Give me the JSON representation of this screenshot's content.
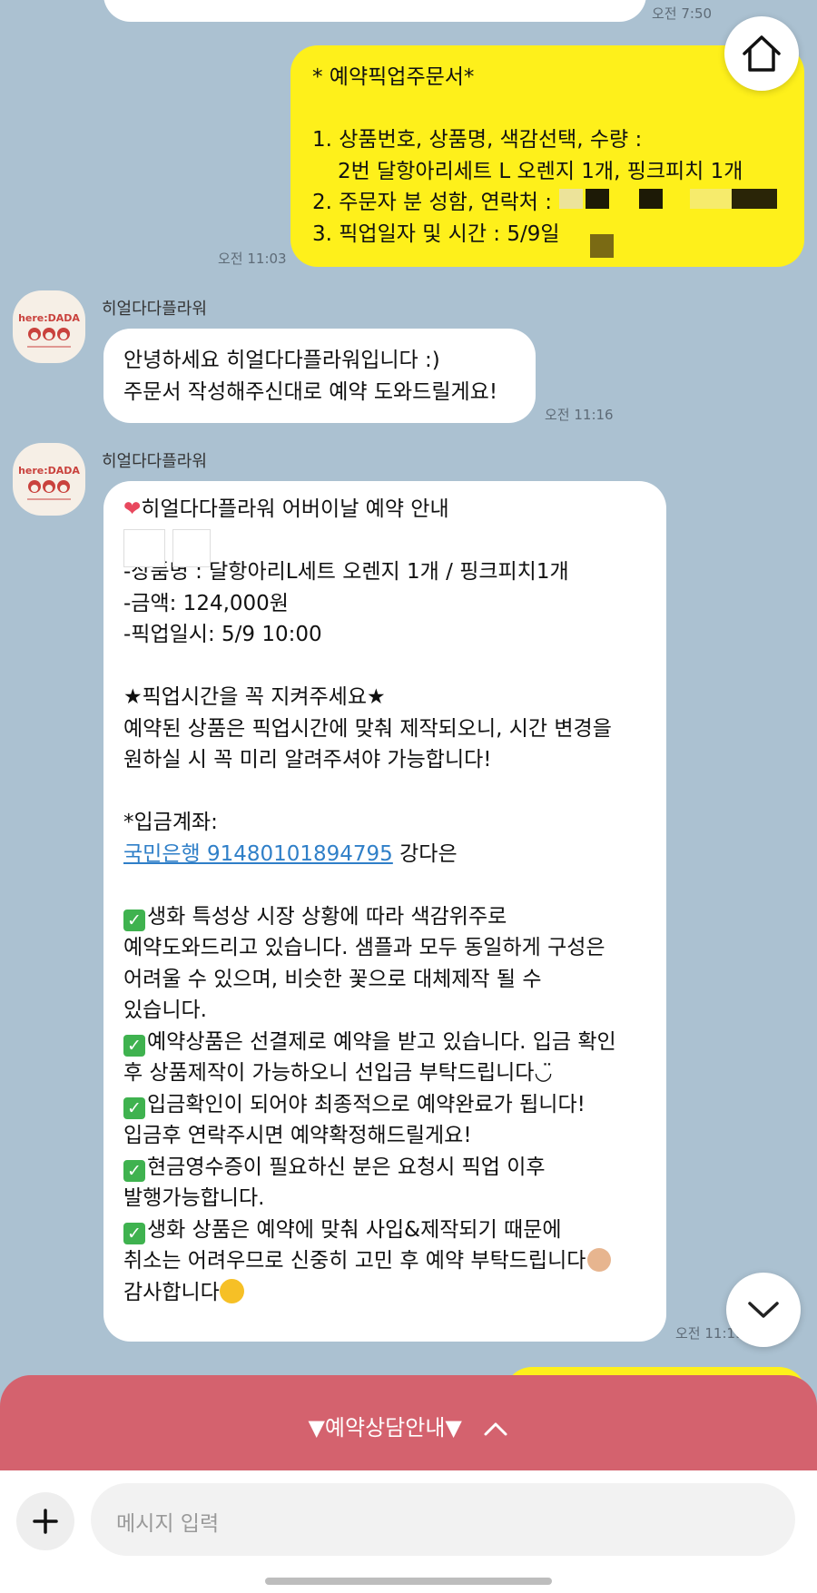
{
  "colors": {
    "chat_bg": "#abc1d1",
    "my_bubble": "#fef01b",
    "their_bubble": "#ffffff",
    "banner": "#d4626e",
    "link": "#2f7fc8"
  },
  "top_time": "오전 7:50",
  "order_message": {
    "lines": [
      "* 예약픽업주문서*",
      "",
      "1. 상품번호, 상품명, 색감선택, 수량 :",
      "   2번 달항아리세트 L 오렌지 1개, 핑크피치 1개",
      "2. 주문자 분 성함, 연락처 :",
      "3. 픽업일자 및 시간 : 5/9일"
    ],
    "time": "오전 11:03"
  },
  "shop": {
    "name": "히얼다다플라워",
    "logo_text": "here:DADA"
  },
  "greeting_message": {
    "lines": [
      "안녕하세요 히얼다다플라워입니다 :)",
      "주문서 작성해주신대로 예약 도와드릴게요!"
    ],
    "time": "오전 11:16"
  },
  "info_message": {
    "title": "히얼다다플라워 어버이날 예약 안내",
    "product": "-상품명 : 달항아리L세트 오렌지 1개 / 핑크피치1개",
    "price": "-금액: 124,000원",
    "pickup": "-픽업일시: 5/9 10:00",
    "notice_title": "★픽업시간을 꼭 지켜주세요★",
    "notice_lines": [
      "예약된 상품은 픽업시간에 맞춰 제작되오니, 시간 변경을",
      "원하실 시 꼭 미리 알려주셔야 가능합니다!"
    ],
    "account_label": "*입금계좌:",
    "account_link": "국민은행 91480101894795",
    "account_holder": " 강다은",
    "check_items": [
      [
        "생화 특성상 시장 상황에 따라 색감위주로",
        "예약도와드리고 있습니다. 샘플과 모두 동일하게 구성은",
        "어려울 수 있으며, 비슷한 꽃으로 대체제작 될 수",
        "있습니다."
      ],
      [
        "예약상품은 선결제로 예약을 받고 있습니다. 입금 확인",
        "후 상품제작이 가능하오니 선입금 부탁드립니다◡̈"
      ],
      [
        "입금확인이 되어야 최종적으로 예약완료가 됩니다!",
        "입금후 연락주시면 예약확정해드릴게요!"
      ],
      [
        "현금영수증이 필요하신 분은 요청시 픽업 이후",
        "발행가능합니다."
      ],
      [
        "생화 상품은 예약에 맞춰 사입&제작되기 때문에",
        "취소는 어려우므로 신중히 고민 후 예약 부탁드립니다"
      ]
    ],
    "closing": "감사합니다",
    "time": "오전 11:19"
  },
  "banner": {
    "label": "▼예약상담안내▼"
  },
  "input": {
    "placeholder": "메시지 입력"
  },
  "icons": {
    "home": "home-icon",
    "scroll_down": "chevron-down-icon",
    "banner_toggle": "chevron-up-icon",
    "add": "plus-icon"
  }
}
